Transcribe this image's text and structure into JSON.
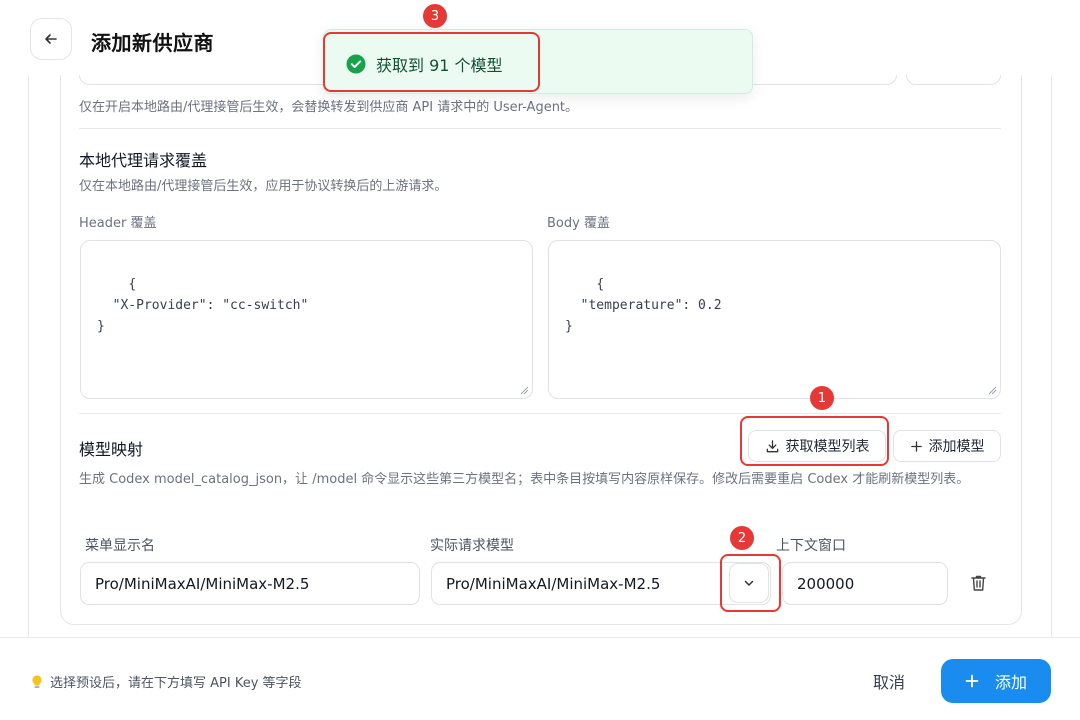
{
  "header": {
    "title": "添加新供应商",
    "back_icon": "arrow-left-icon"
  },
  "user_agent_section": {
    "hint": "仅在开启本地路由/代理接管后生效，会替换转发到供应商 API 请求中的 User-Agent。"
  },
  "proxy_override": {
    "title": "本地代理请求覆盖",
    "hint": "仅在本地路由/代理接管后生效，应用于协议转换后的上游请求。",
    "header_label": "Header 覆盖",
    "header_value": "{\n  \"X-Provider\": \"cc-switch\"\n}",
    "body_label": "Body 覆盖",
    "body_value": "{\n  \"temperature\": 0.2\n}"
  },
  "model_mapping": {
    "title": "模型映射",
    "fetch_button": "获取模型列表",
    "fetch_icon": "download-icon",
    "add_button": "添加模型",
    "add_icon": "plus-icon",
    "description": "生成 Codex model_catalog_json，让 /model 命令显示这些第三方模型名；表中条目按填写内容原样保存。修改后需要重启 Codex 才能刷新模型列表。",
    "columns": [
      "菜单显示名",
      "实际请求模型",
      "上下文窗口"
    ],
    "rows": [
      {
        "display_name": "Pro/MiniMaxAI/MiniMax-M2.5",
        "request_model": "Pro/MiniMaxAI/MiniMax-M2.5",
        "context_window": "200000"
      }
    ],
    "dropdown_icon": "chevron-down-icon",
    "delete_icon": "trash-icon"
  },
  "footer": {
    "hint_icon": "lightbulb-icon",
    "hint": "选择预设后，请在下方填写 API Key 等字段",
    "cancel": "取消",
    "add": "添加",
    "add_icon": "plus-icon"
  },
  "toast": {
    "icon": "check-circle-icon",
    "message": "获取到 91 个模型"
  },
  "annotations": {
    "badge1": "1",
    "badge2": "2",
    "badge3": "3"
  },
  "colors": {
    "accent": "#1a8cf0",
    "success": "#16a34a",
    "highlight": "#e53935"
  }
}
